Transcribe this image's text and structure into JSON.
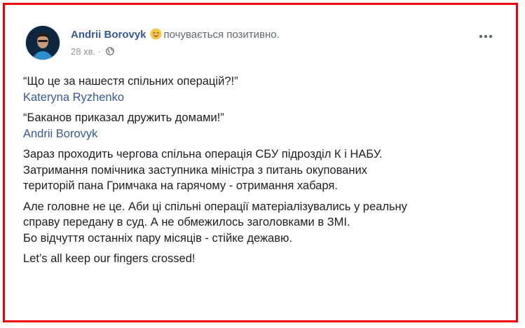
{
  "post": {
    "author": "Andrii Borovyk",
    "feeling_emoji": "smiling-face-icon",
    "feeling_text": "почувається позитивно.",
    "timestamp": "28 хв.",
    "separator": "·",
    "audience_icon": "globe-icon",
    "more_icon": "more-options-icon",
    "paragraphs": [
      {
        "text": "“Що це за нашестя спільних операцій?!”",
        "link": "Kateryna Ryzhenko"
      },
      {
        "text": "“Баканов приказал дружить домами!”",
        "link": "Andrii Borovyk"
      },
      {
        "lines": [
          "Зараз проходить чергова спільна операція СБУ підрозділ К і НАБУ.",
          "Затримання помічника заступника міністра з питань окупованих",
          "територій пана Гримчака на гарячому - отримання хабаря."
        ]
      },
      {
        "lines": [
          "Але головне не це. Аби ці спільні операції матеріалізувались у реальну",
          "справу передану в суд. А не обмежилось заголовками в ЗМІ.",
          "Бо відчуття останніх пару місяців - стійке дежавю."
        ]
      },
      {
        "text": "Let’s all keep our fingers crossed!"
      }
    ]
  },
  "colors": {
    "frame_border": "#e8000b",
    "link": "#385898",
    "text": "#1c1e21",
    "meta": "#90949c"
  }
}
